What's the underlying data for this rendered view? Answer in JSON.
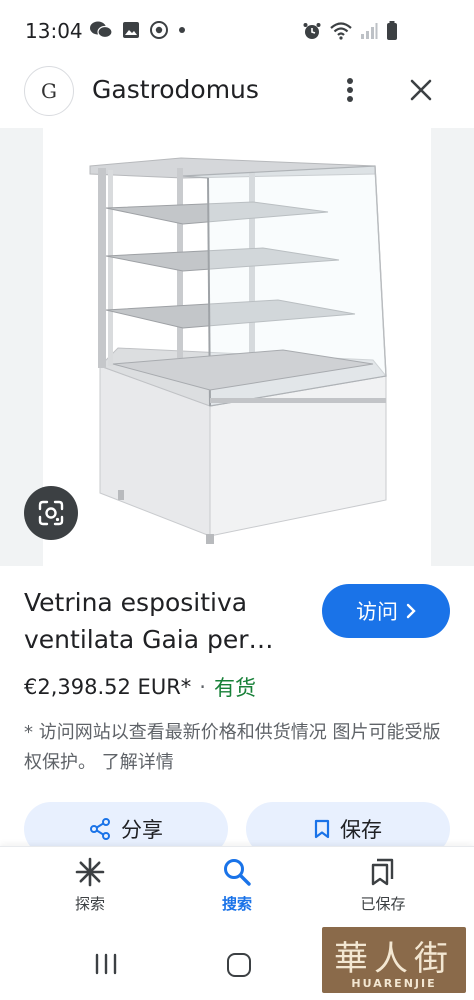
{
  "status_bar": {
    "time": "13:04",
    "left_icons": [
      "wechat-icon",
      "image-icon",
      "chrome-icon",
      "dot-icon"
    ],
    "right_icons": [
      "alarm-icon",
      "wifi-icon",
      "signal-icon",
      "battery-icon"
    ]
  },
  "header": {
    "logo_letter": "G",
    "site_name": "Gastrodomus"
  },
  "product": {
    "title": "Vetrina espositiva ventilata Gaia per…",
    "visit_label": "访问",
    "price": "€2,398.52 EUR*",
    "separator": "·",
    "stock": "有货",
    "disclaimer": "* 访问网站以查看最新价格和供货情况 图片可能受版权保护。 了解详情"
  },
  "actions": {
    "share_label": "分享",
    "save_label": "保存"
  },
  "bottom_nav": {
    "items": [
      {
        "label": "探索",
        "icon": "asterisk-icon"
      },
      {
        "label": "搜索",
        "icon": "search-icon"
      },
      {
        "label": "已保存",
        "icon": "bookmarks-icon"
      }
    ]
  },
  "watermark": {
    "main": "華人街",
    "sub": "HUARENJIE"
  },
  "colors": {
    "accent": "#1a73e8",
    "stock": "#188038",
    "chip_bg": "#e8f0fe"
  }
}
